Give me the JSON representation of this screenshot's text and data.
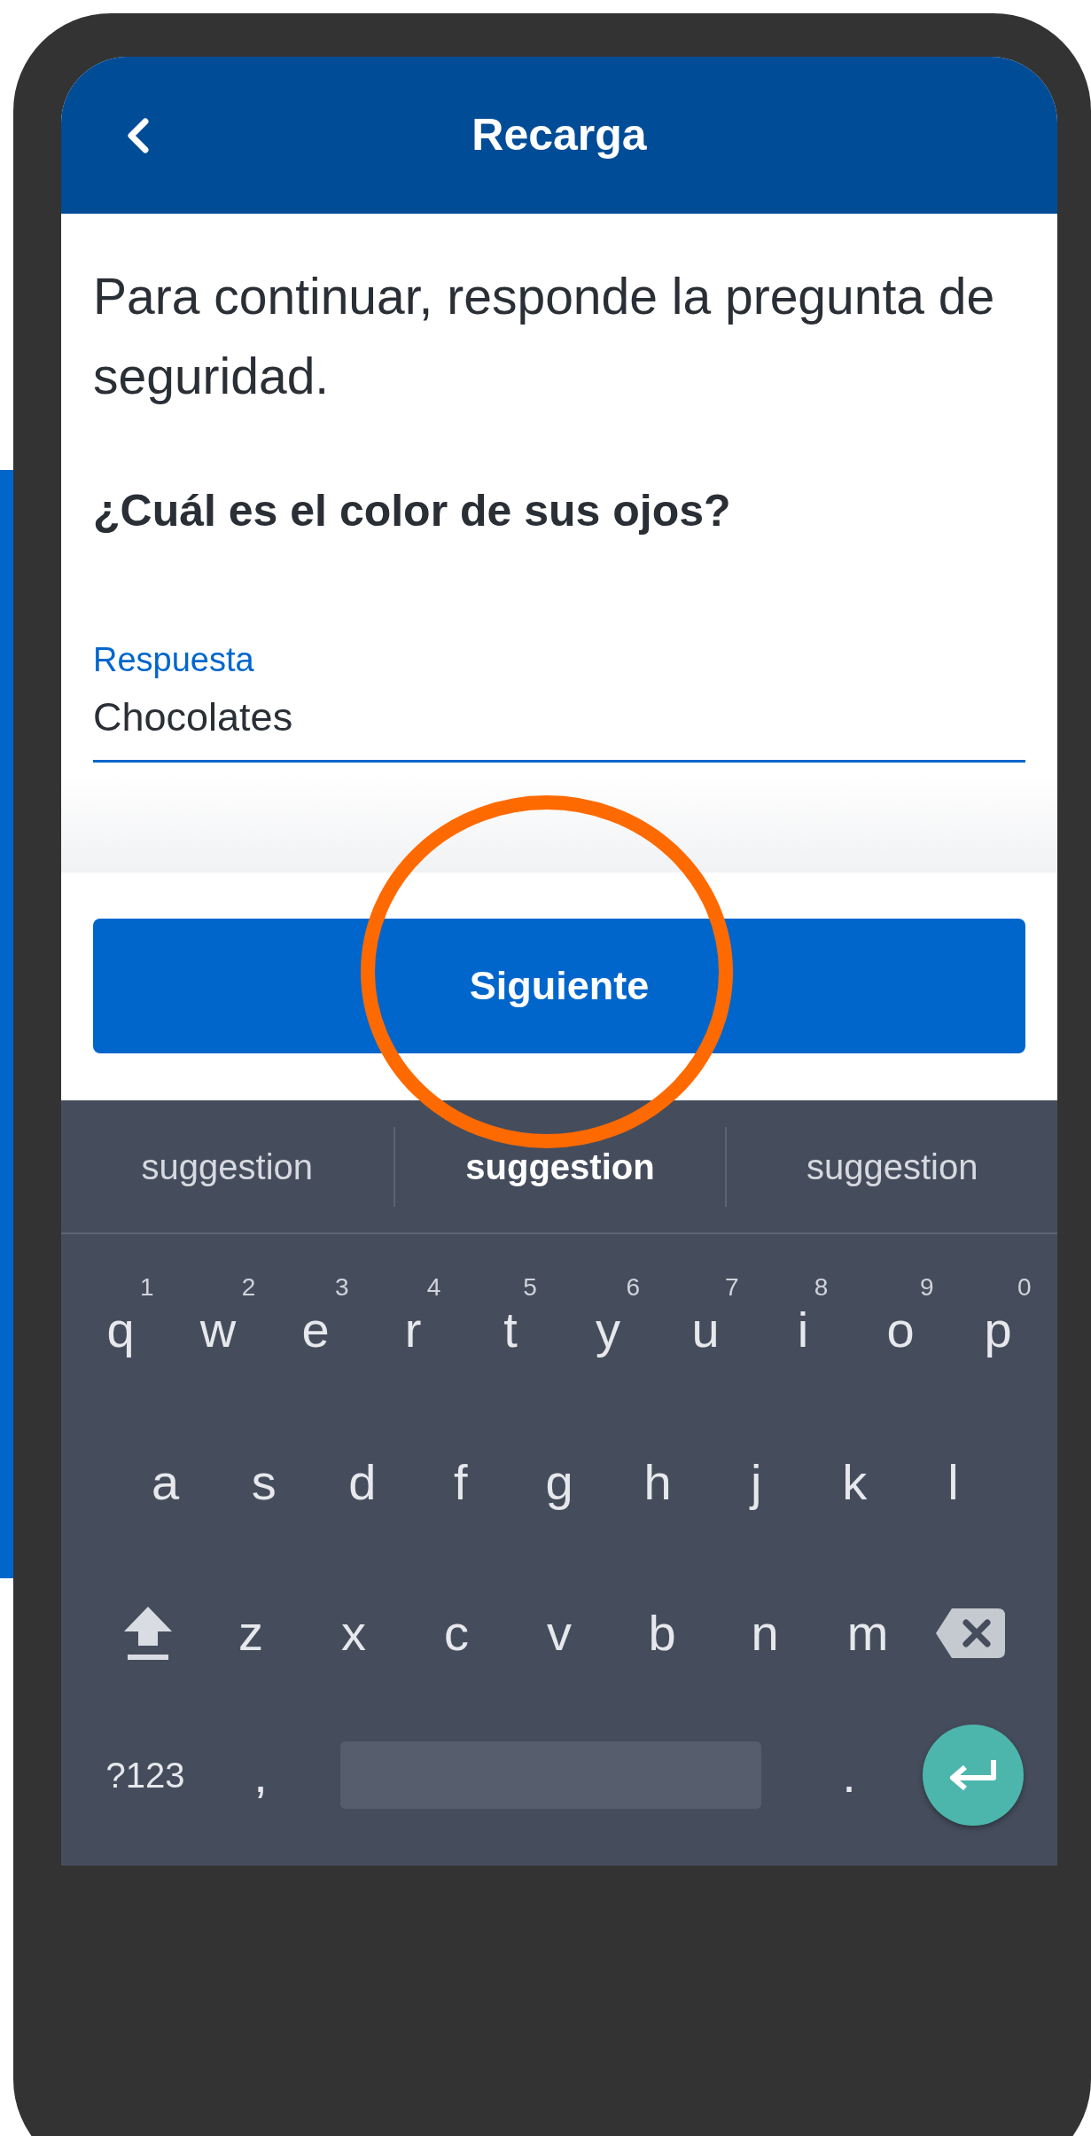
{
  "header": {
    "title": "Recarga"
  },
  "instruction": "Para continuar, responde la pregunta de seguridad.",
  "question": "¿Cuál es el color de sus ojos?",
  "field": {
    "label": "Respuesta",
    "value": "Chocolates"
  },
  "button": "Siguiente",
  "keyboard": {
    "suggestions": [
      {
        "text": "suggestion",
        "selected": false
      },
      {
        "text": "suggestion",
        "selected": true
      },
      {
        "text": "suggestion",
        "selected": false
      }
    ],
    "rows": [
      [
        {
          "kind": "char",
          "key": "q",
          "hint": "1"
        },
        {
          "kind": "char",
          "key": "w",
          "hint": "2"
        },
        {
          "kind": "char",
          "key": "e",
          "hint": "3"
        },
        {
          "kind": "char",
          "key": "r",
          "hint": "4"
        },
        {
          "kind": "char",
          "key": "t",
          "hint": "5"
        },
        {
          "kind": "char",
          "key": "y",
          "hint": "6"
        },
        {
          "kind": "char",
          "key": "u",
          "hint": "7"
        },
        {
          "kind": "char",
          "key": "i",
          "hint": "8"
        },
        {
          "kind": "char",
          "key": "o",
          "hint": "9"
        },
        {
          "kind": "char",
          "key": "p",
          "hint": "0"
        }
      ],
      [
        {
          "kind": "char",
          "key": "a"
        },
        {
          "kind": "char",
          "key": "s"
        },
        {
          "kind": "char",
          "key": "d"
        },
        {
          "kind": "char",
          "key": "f"
        },
        {
          "kind": "char",
          "key": "g"
        },
        {
          "kind": "char",
          "key": "h"
        },
        {
          "kind": "char",
          "key": "j"
        },
        {
          "kind": "char",
          "key": "k"
        },
        {
          "kind": "char",
          "key": "l"
        }
      ],
      [
        {
          "kind": "shift"
        },
        {
          "kind": "char",
          "key": "z"
        },
        {
          "kind": "char",
          "key": "x"
        },
        {
          "kind": "char",
          "key": "c"
        },
        {
          "kind": "char",
          "key": "v"
        },
        {
          "kind": "char",
          "key": "b"
        },
        {
          "kind": "char",
          "key": "n"
        },
        {
          "kind": "char",
          "key": "m"
        },
        {
          "kind": "backspace"
        }
      ],
      [
        {
          "kind": "mode",
          "key": "?123"
        },
        {
          "kind": "char",
          "key": ","
        },
        {
          "kind": "space"
        },
        {
          "kind": "char",
          "key": "."
        },
        {
          "kind": "enter"
        }
      ]
    ]
  }
}
